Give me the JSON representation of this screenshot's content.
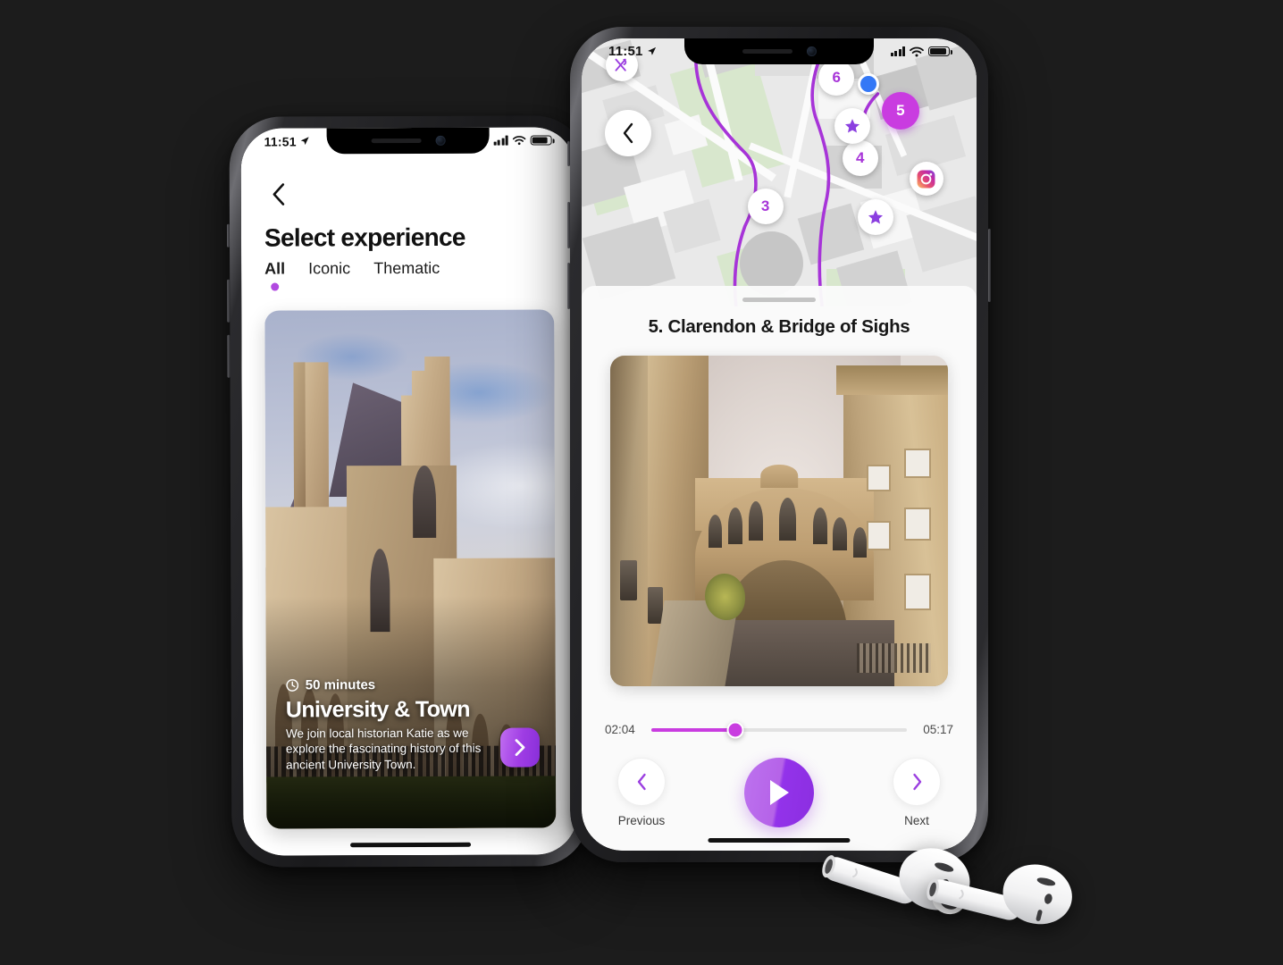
{
  "scene": {
    "background_color": "#1c1c1c",
    "accent_color": "#a734d8",
    "accent_bright": "#c93ce0"
  },
  "left_phone": {
    "statusbar": {
      "time": "11:51",
      "location_icon": "location-arrow-icon",
      "signal_icon": "cellular-signal-icon",
      "wifi_icon": "wifi-icon",
      "battery_icon": "battery-icon"
    },
    "back_icon": "chevron-left-icon",
    "title": "Select experience",
    "tabs": [
      {
        "label": "All",
        "active": true
      },
      {
        "label": "Iconic",
        "active": false
      },
      {
        "label": "Thematic",
        "active": false
      }
    ],
    "card": {
      "duration_icon": "clock-icon",
      "duration": "50 minutes",
      "name": "University & Town",
      "description": "We join local historian Katie as we explore the fascinating history of this ancient University Town.",
      "go_icon": "chevron-right-icon",
      "image_alt": "gothic-college-building"
    }
  },
  "right_phone": {
    "statusbar": {
      "time": "11:51",
      "location_icon": "location-arrow-icon",
      "signal_icon": "cellular-signal-icon",
      "wifi_icon": "wifi-icon",
      "battery_icon": "battery-icon"
    },
    "map": {
      "back_icon": "chevron-left-icon",
      "restaurant_pin_icon": "restaurant-fork-knife-icon",
      "instagram_pin_icon": "instagram-icon",
      "user_location_icon": "user-location-dot",
      "markers": [
        {
          "label": "3",
          "active": false
        },
        {
          "label": "4",
          "active": false
        },
        {
          "label": "5",
          "active": true
        },
        {
          "label": "6",
          "active": false
        }
      ],
      "star_pins": 2,
      "star_icon": "star-icon"
    },
    "sheet": {
      "handle": "drag-handle",
      "title": "5. Clarendon & Bridge of Sighs",
      "image_alt": "bridge-of-sighs-oxford"
    },
    "player": {
      "elapsed": "02:04",
      "total": "05:17",
      "progress_percent": 33,
      "play_icon": "play-icon",
      "previous": {
        "label": "Previous",
        "icon": "chevron-left-icon"
      },
      "next": {
        "label": "Next",
        "icon": "chevron-right-icon"
      }
    }
  },
  "airpods": {
    "alt": "airpods-earbuds",
    "count": 2
  }
}
